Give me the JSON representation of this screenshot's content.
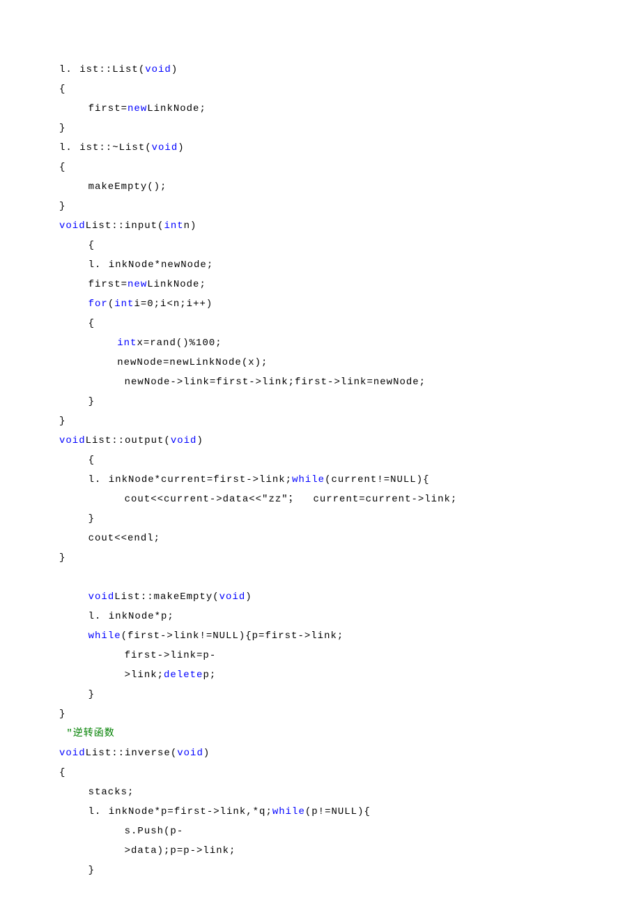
{
  "code": {
    "l01": "l. ist::List(",
    "l01_kw": "void",
    "l01b": ")",
    "l02": "{",
    "l03a": "    first=",
    "l03_kw": "new",
    "l03b": "LinkNode;",
    "l04": "}",
    "l05": "l. ist::~List(",
    "l05_kw": "void",
    "l05b": ")",
    "l06": "{",
    "l07": "    makeEmpty();",
    "l08": "}",
    "l09_kw": "void",
    "l09a": "List::input(",
    "l09_kw2": "int",
    "l09b": "n)",
    "l10": "    {",
    "l11": "    l. inkNode*newNode;",
    "l12a": "    first=",
    "l12_kw": "new",
    "l12b": "LinkNode;",
    "l13a": "    ",
    "l13_kw": "for",
    "l13b": "(",
    "l13_kw2": "int",
    "l13c": "i=0;i<n;i++)",
    "l14": "    {",
    "l15a": "        ",
    "l15_kw": "int",
    "l15b": "x=rand()%100;",
    "l16": "        newNode=newLinkNode(x);",
    "l17": "         newNode->link=first->link;first->link=newNode;",
    "l18": "    }",
    "l19": "}",
    "l20_kw": "void",
    "l20a": "List::output(",
    "l20_kw2": "void",
    "l20b": ")",
    "l21": "    {",
    "l22a": "    l. inkNode*current=first->link;",
    "l22_kw": "while",
    "l22b": "(current!=NULL){",
    "l23": "         cout<<current->data<<\"zz\"；  current=current->link;",
    "l24": "    }",
    "l25": "    cout<<endl;",
    "l26": "}",
    "l28a": "    ",
    "l28_kw": "void",
    "l28b": "List::makeEmpty(",
    "l28_kw2": "void",
    "l28c": ")",
    "l29": "    l. inkNode*p;",
    "l30a": "    ",
    "l30_kw": "while",
    "l30b": "(first->link!=NULL){p=first->link;",
    "l31": "         first->link=p-",
    "l32a": "         >link;",
    "l32_kw": "delete",
    "l32b": "p;",
    "l33": "    }",
    "l34": "}",
    "l35_cm": " \"逆转函数",
    "l36_kw": "void",
    "l36a": "List::inverse(",
    "l36_kw2": "void",
    "l36b": ")",
    "l37": "{",
    "l38": "    stacks;",
    "l39a": "    l. inkNode*p=first->link,*q;",
    "l39_kw": "while",
    "l39b": "(p!=NULL){",
    "l40": "         s.Push(p-",
    "l41": "         >data);p=p->link;",
    "l42": "    }"
  }
}
